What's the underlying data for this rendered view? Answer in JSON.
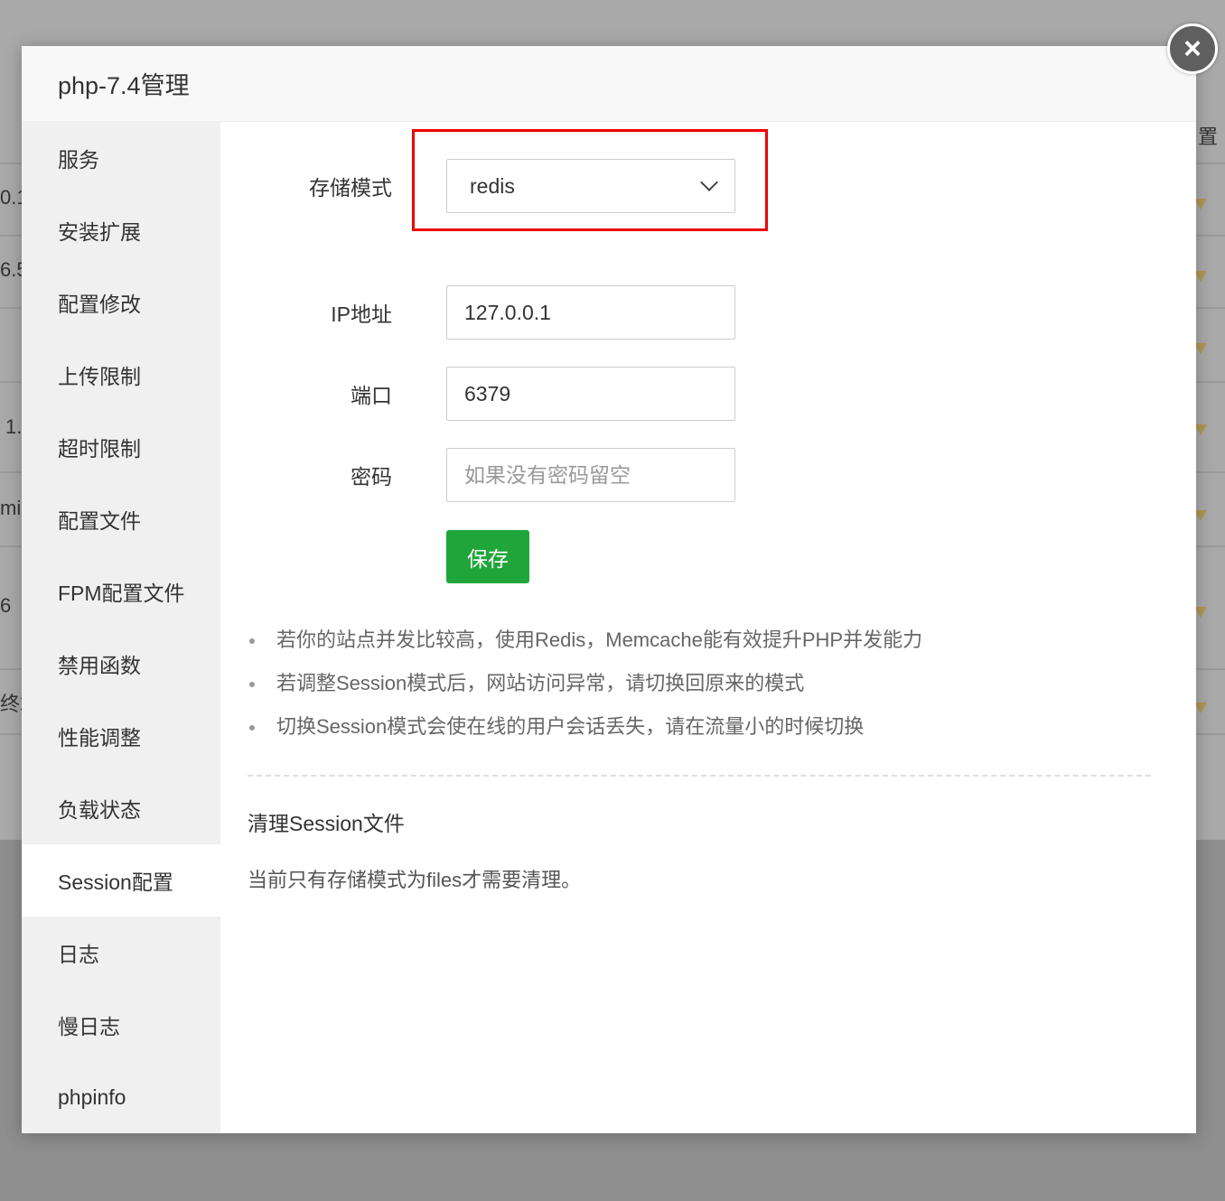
{
  "background": {
    "fragments": [
      "0.1",
      "6.5",
      "1.",
      "mi",
      "6",
      "终端",
      "置"
    ]
  },
  "dialog": {
    "title": "php-7.4管理",
    "close_icon": "×"
  },
  "sidebar": {
    "items": [
      {
        "label": "服务",
        "active": false
      },
      {
        "label": "安装扩展",
        "active": false
      },
      {
        "label": "配置修改",
        "active": false
      },
      {
        "label": "上传限制",
        "active": false
      },
      {
        "label": "超时限制",
        "active": false
      },
      {
        "label": "配置文件",
        "active": false
      },
      {
        "label": "FPM配置文件",
        "active": false
      },
      {
        "label": "禁用函数",
        "active": false
      },
      {
        "label": "性能调整",
        "active": false
      },
      {
        "label": "负载状态",
        "active": false
      },
      {
        "label": "Session配置",
        "active": true
      },
      {
        "label": "日志",
        "active": false
      },
      {
        "label": "慢日志",
        "active": false
      },
      {
        "label": "phpinfo",
        "active": false
      }
    ]
  },
  "form": {
    "storage": {
      "label": "存储模式",
      "value": "redis"
    },
    "ip": {
      "label": "IP地址",
      "value": "127.0.0.1"
    },
    "port": {
      "label": "端口",
      "value": "6379"
    },
    "password": {
      "label": "密码",
      "value": "",
      "placeholder": "如果没有密码留空"
    },
    "save_label": "保存"
  },
  "tips": [
    "若你的站点并发比较高，使用Redis，Memcache能有效提升PHP并发能力",
    "若调整Session模式后，网站访问异常，请切换回原来的模式",
    "切换Session模式会使在线的用户会话丢失，请在流量小的时候切换"
  ],
  "cleanup": {
    "title": "清理Session文件",
    "text": "当前只有存储模式为files才需要清理。"
  },
  "colors": {
    "accent_green": "#20a53a",
    "highlight_red": "#ee0000"
  }
}
